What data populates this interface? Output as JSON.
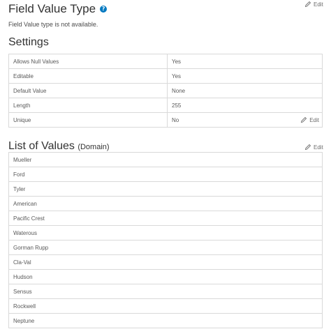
{
  "field_value_type": {
    "title": "Field Value Type",
    "help_glyph": "?",
    "description": "Field Value type is not available.",
    "edit_label": "Edit"
  },
  "settings": {
    "title": "Settings",
    "rows": [
      {
        "key": "Allows Null Values",
        "value": "Yes"
      },
      {
        "key": "Editable",
        "value": "Yes"
      },
      {
        "key": "Default Value",
        "value": "None"
      },
      {
        "key": "Length",
        "value": "255"
      },
      {
        "key": "Unique",
        "value": "No"
      }
    ],
    "edit_label": "Edit"
  },
  "list_of_values": {
    "title": "List of Values",
    "subtitle": "(Domain)",
    "edit_label": "Edit",
    "items": [
      "Mueller",
      "Ford",
      "Tyler",
      "American",
      "Pacific Crest",
      "Waterous",
      "Gorman Rupp",
      "Cla-Val",
      "Hudson",
      "Sensus",
      "Rockwell",
      "Neptune"
    ]
  },
  "colors": {
    "help_icon": "#0079c1",
    "border": "#d9d9d9"
  }
}
